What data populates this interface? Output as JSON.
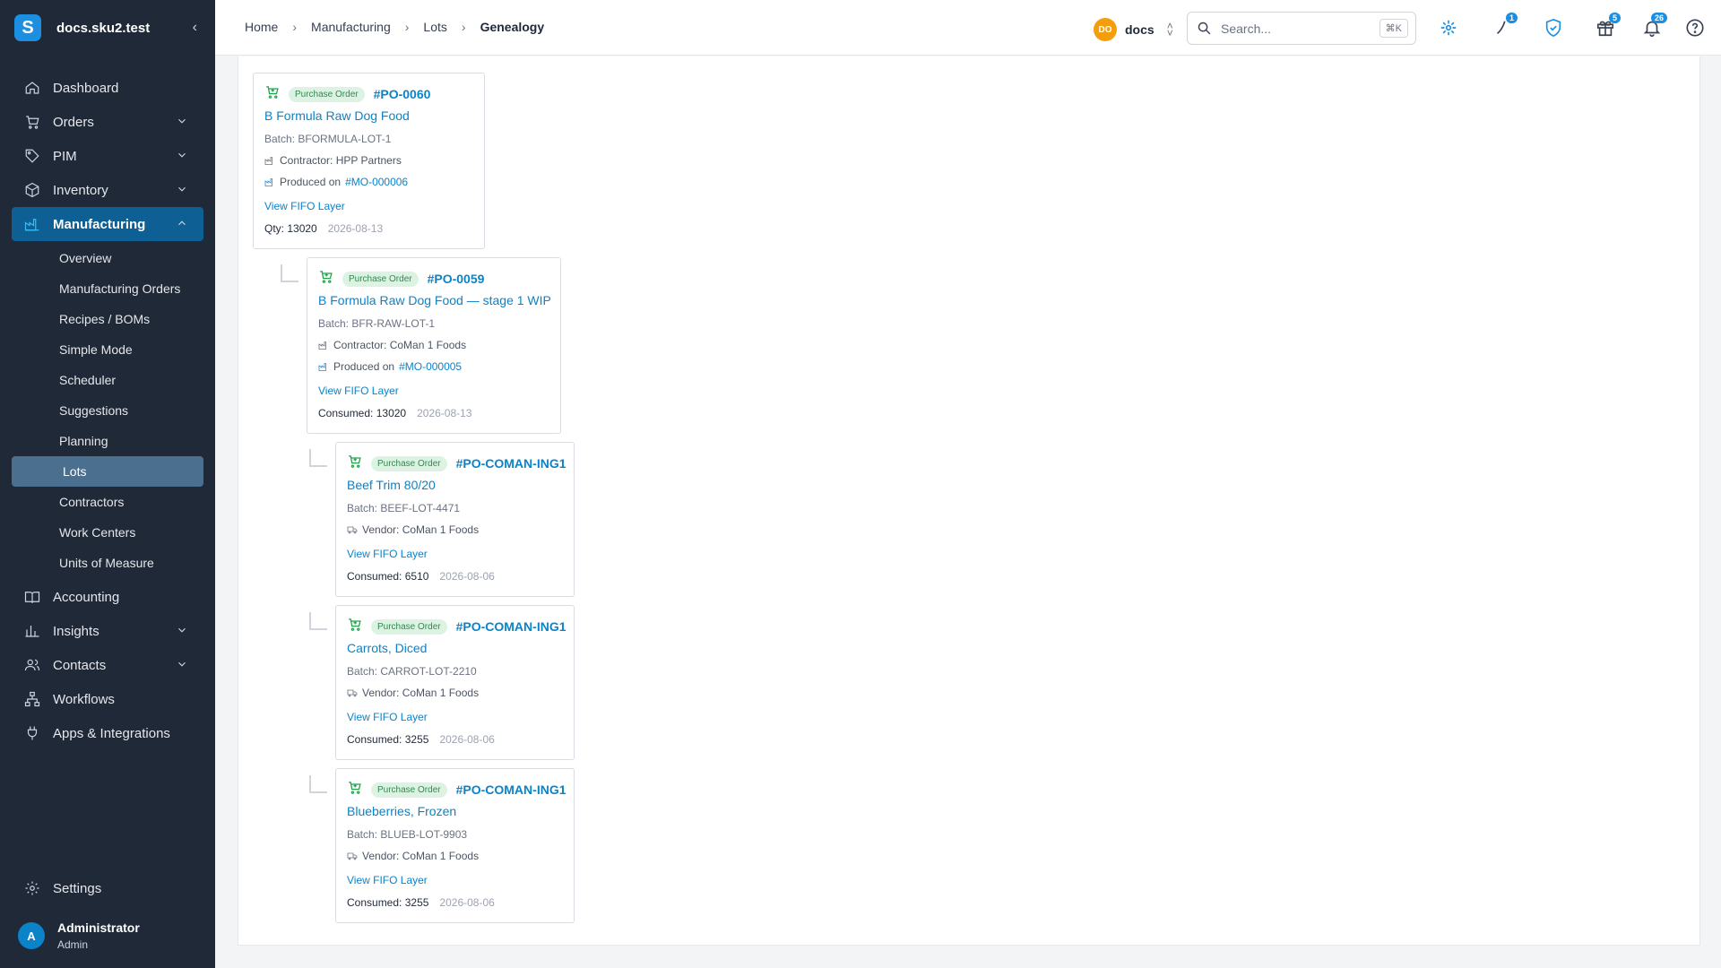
{
  "sidebar": {
    "brand_logo": "S",
    "brand_name": "docs.sku2.test",
    "items": [
      {
        "label": "Dashboard"
      },
      {
        "label": "Orders"
      },
      {
        "label": "PIM"
      },
      {
        "label": "Inventory"
      },
      {
        "label": "Manufacturing"
      },
      {
        "label": "Accounting"
      },
      {
        "label": "Insights"
      },
      {
        "label": "Contacts"
      },
      {
        "label": "Workflows"
      },
      {
        "label": "Apps & Integrations"
      }
    ],
    "manufacturing_sub": [
      "Overview",
      "Manufacturing Orders",
      "Recipes / BOMs",
      "Simple Mode",
      "Scheduler",
      "Suggestions",
      "Planning",
      "Lots",
      "Contractors",
      "Work Centers",
      "Units of Measure"
    ],
    "settings_label": "Settings",
    "user": {
      "initial": "A",
      "name": "Administrator",
      "role": "Admin"
    }
  },
  "header": {
    "breadcrumb": [
      "Home",
      "Manufacturing",
      "Lots",
      "Genealogy"
    ],
    "org_initials": "DO",
    "org_name": "docs",
    "search_placeholder": "Search...",
    "search_shortcut": "⌘K",
    "badges": {
      "phone": "1",
      "gift": "5",
      "bell": "26"
    }
  },
  "genealogy": [
    {
      "type_label": "Purchase Order",
      "po": "#PO-0060",
      "product": "B Formula Raw Dog Food",
      "batch": "Batch: BFORMULA-LOT-1",
      "party": "Contractor: HPP Partners",
      "produced_label": "Produced on",
      "mo": "#MO-000006",
      "fifo": "View FIFO Layer",
      "qty_label": "Qty:",
      "qty": "13020",
      "date": "2026-08-13"
    },
    {
      "type_label": "Purchase Order",
      "po": "#PO-0059",
      "product": "B Formula Raw Dog Food — stage 1 WIP",
      "batch": "Batch: BFR-RAW-LOT-1",
      "party": "Contractor: CoMan 1 Foods",
      "produced_label": "Produced on",
      "mo": "#MO-000005",
      "fifo": "View FIFO Layer",
      "qty_label": "Consumed:",
      "qty": "13020",
      "date": "2026-08-13"
    },
    {
      "type_label": "Purchase Order",
      "po": "#PO-COMAN-ING1",
      "product": "Beef Trim 80/20",
      "batch": "Batch: BEEF-LOT-4471",
      "party": "Vendor: CoMan 1 Foods",
      "fifo": "View FIFO Layer",
      "qty_label": "Consumed:",
      "qty": "6510",
      "date": "2026-08-06"
    },
    {
      "type_label": "Purchase Order",
      "po": "#PO-COMAN-ING1",
      "product": "Carrots, Diced",
      "batch": "Batch: CARROT-LOT-2210",
      "party": "Vendor: CoMan 1 Foods",
      "fifo": "View FIFO Layer",
      "qty_label": "Consumed:",
      "qty": "3255",
      "date": "2026-08-06"
    },
    {
      "type_label": "Purchase Order",
      "po": "#PO-COMAN-ING1",
      "product": "Blueberries, Frozen",
      "batch": "Batch: BLUEB-LOT-9903",
      "party": "Vendor: CoMan 1 Foods",
      "fifo": "View FIFO Layer",
      "qty_label": "Consumed:",
      "qty": "3255",
      "date": "2026-08-06"
    }
  ]
}
